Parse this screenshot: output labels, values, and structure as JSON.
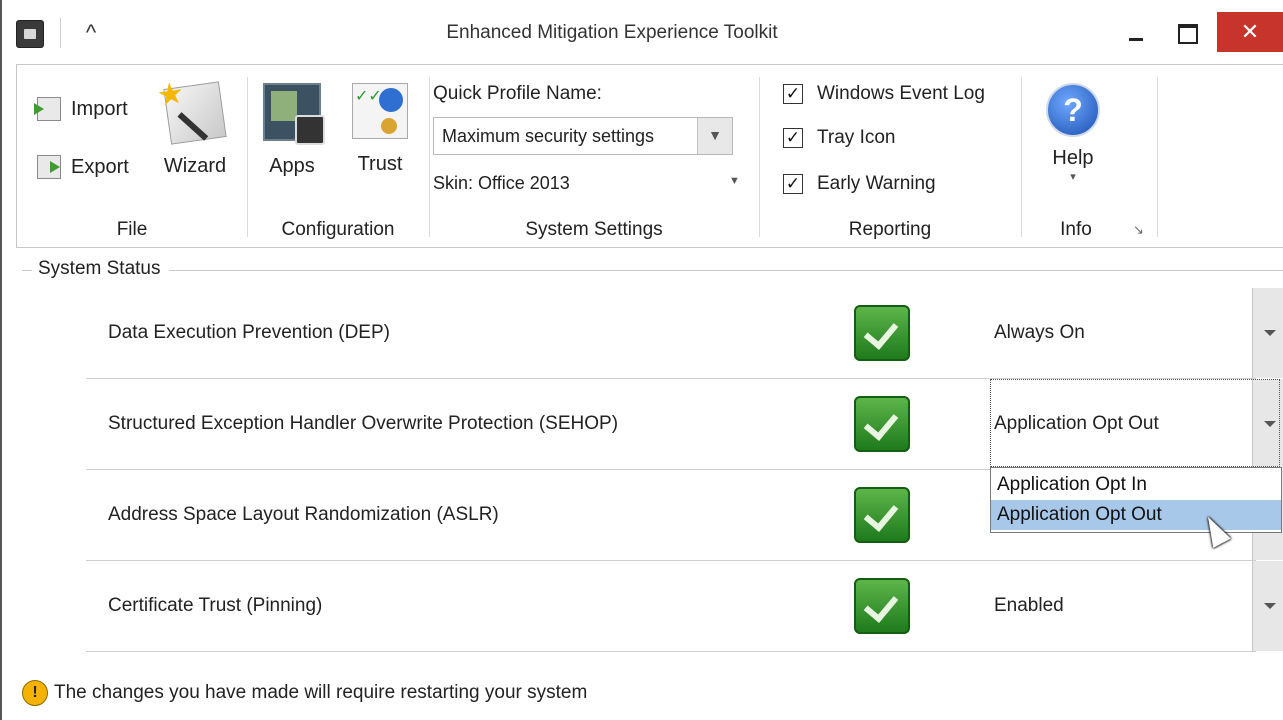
{
  "window": {
    "title": "Enhanced Mitigation Experience Toolkit",
    "close_glyph": "✕",
    "collapse_glyph": "^"
  },
  "ribbon": {
    "file": {
      "group_label": "File",
      "import_label": "Import",
      "export_label": "Export",
      "wizard_label": "Wizard"
    },
    "configuration": {
      "group_label": "Configuration",
      "apps_label": "Apps",
      "trust_label": "Trust"
    },
    "system_settings": {
      "group_label": "System Settings",
      "quick_profile_label": "Quick Profile Name:",
      "quick_profile_value": "Maximum security settings",
      "skin_label": "Skin: Office 2013"
    },
    "reporting": {
      "group_label": "Reporting",
      "checkboxes": [
        {
          "label": "Windows Event Log",
          "checked": true
        },
        {
          "label": "Tray Icon",
          "checked": true
        },
        {
          "label": "Early Warning",
          "checked": true
        }
      ],
      "check_glyph": "✓"
    },
    "info": {
      "group_label": "Info",
      "help_label": "Help",
      "help_glyph": "?",
      "launcher_glyph": "↘",
      "dropdown_glyph": "▾"
    }
  },
  "system_status": {
    "title": "System Status",
    "rows": [
      {
        "label": "Data Execution Prevention (DEP)",
        "value": "Always On",
        "enabled": true
      },
      {
        "label": "Structured Exception Handler Overwrite Protection (SEHOP)",
        "value": "Application Opt Out",
        "enabled": true
      },
      {
        "label": "Address Space Layout Randomization (ASLR)",
        "value": "",
        "enabled": true
      },
      {
        "label": "Certificate Trust (Pinning)",
        "value": "Enabled",
        "enabled": true
      }
    ],
    "open_dropdown": {
      "options": [
        "Application Opt In",
        "Application Opt Out"
      ],
      "highlighted": "Application Opt Out"
    }
  },
  "footer": {
    "message": "The changes you have made will require restarting your system",
    "warning_glyph": "!"
  },
  "colors": {
    "close_red": "#c7342c",
    "check_green": "#2e8b2a",
    "highlight_blue": "#a8c8ea",
    "warning_yellow": "#f3b300"
  }
}
